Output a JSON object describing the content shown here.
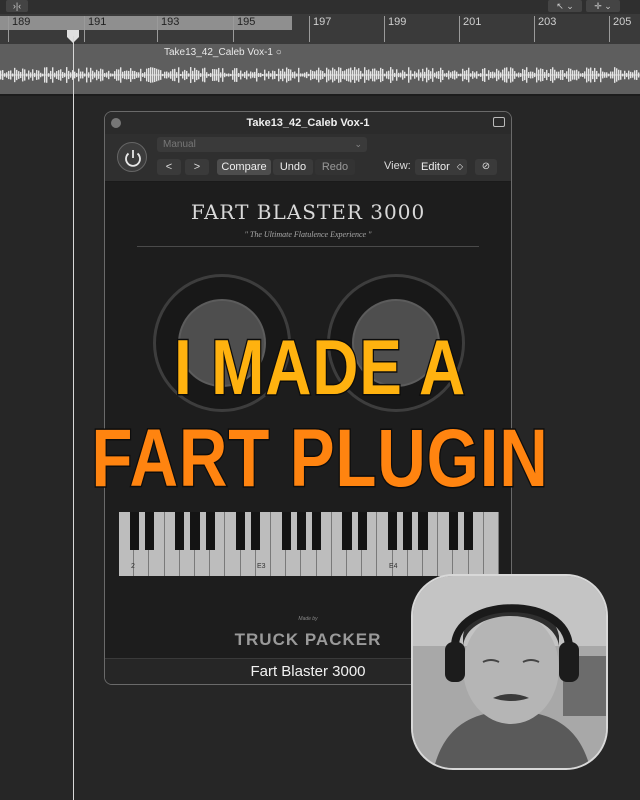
{
  "toolbar": {
    "left_icon": "collapse-icon",
    "cursor_tool": "pointer-tool-icon",
    "pencil_tool": "pencil-tool-icon"
  },
  "ruler": {
    "bars": [
      "189",
      "191",
      "193",
      "195",
      "197",
      "199",
      "201",
      "203",
      "205"
    ]
  },
  "track": {
    "region_name": "Take13_42_Caleb Vox-1"
  },
  "plugin": {
    "window_title": "Take13_42_Caleb Vox-1",
    "preset": "Manual",
    "nav_prev": "<",
    "nav_next": ">",
    "compare": "Compare",
    "undo": "Undo",
    "redo": "Redo",
    "view_label": "View:",
    "view_value": "Editor",
    "name": "FART BLASTER 3000",
    "tagline": "\" The Ultimate Flatulence Experience \"",
    "key_labels": [
      "2",
      "E3",
      "E4"
    ],
    "made_by": "Made by",
    "brand": "TRUCK PACKER",
    "footer_title": "Fart Blaster 3000"
  },
  "overlay": {
    "line1": "I MADE A",
    "line2": "FART PLUGIN"
  },
  "colors": {
    "caption_top": "#ffb20f",
    "caption_bottom": "#ff8410",
    "window_bg": "#1e1e1e",
    "ruler_cycle": "#8f8f8f"
  }
}
